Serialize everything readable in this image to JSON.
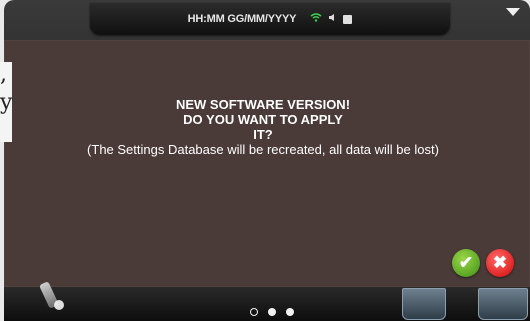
{
  "status_bar": {
    "clock_format": "HH:MM GG/MM/YYYY",
    "icons": [
      "wifi-icon",
      "speaker-icon",
      "battery-icon"
    ]
  },
  "page_edge": {
    "glyph_top": ",",
    "glyph_bottom": "y"
  },
  "dialog": {
    "title_line1": "NEW SOFTWARE VERSION!",
    "title_line2": "DO YOU WANT TO APPLY",
    "title_line3": "IT?",
    "note": "(The Settings Database will be recreated, all data will be lost)",
    "confirm_symbol": "✔",
    "cancel_symbol": "✖",
    "colors": {
      "background": "#4a3a38",
      "confirm": "#5aa524",
      "cancel": "#e02424"
    }
  },
  "pager": {
    "total_pages": 3,
    "active_page": 2
  }
}
